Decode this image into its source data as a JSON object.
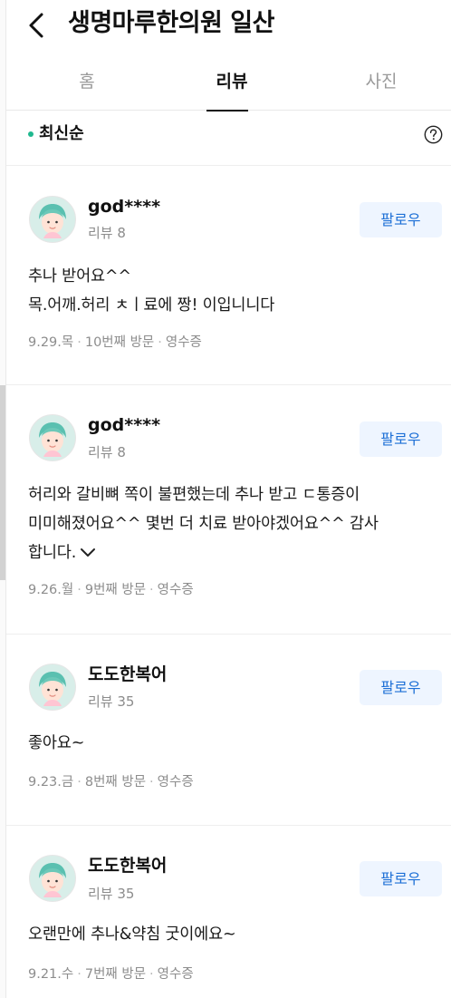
{
  "header": {
    "title": "생명마루한의원 일산",
    "back_icon": "chevron-left-icon"
  },
  "tabs": [
    {
      "label": "홈",
      "active": false
    },
    {
      "label": "리뷰",
      "active": true
    },
    {
      "label": "사진",
      "active": false
    }
  ],
  "sort": {
    "label": "최신순",
    "help_icon": "question-circle-icon"
  },
  "colors": {
    "accent": "#1fb88f",
    "follow_text": "#1c6fd6",
    "follow_bg": "#eef5ff"
  },
  "reviews": [
    {
      "nickname": "god****",
      "review_count": "리뷰 8",
      "follow_label": "팔로우",
      "lines": [
        "추나 받어요^^",
        "목.어깨.허리 ㅊㅣ료에 짱! 이입니니다"
      ],
      "date": "9.29.목",
      "visit": "10번째 방문",
      "receipt": "영수증"
    },
    {
      "nickname": "god****",
      "review_count": "리뷰 8",
      "follow_label": "팔로우",
      "lines": [
        "허리와 갈비뼈 쪽이 불편했는데 추나 받고 ㄷ통증이",
        "미미해졌어요^^ 몇번 더 치료 받아야겠어요^^ 감사",
        "합니다."
      ],
      "more_icon": "chevron-down-icon",
      "date": "9.26.월",
      "visit": "9번째 방문",
      "receipt": "영수증"
    },
    {
      "nickname": "도도한복어",
      "review_count": "리뷰 35",
      "follow_label": "팔로우",
      "lines": [
        "좋아요~"
      ],
      "date": "9.23.금",
      "visit": "8번째 방문",
      "receipt": "영수증"
    },
    {
      "nickname": "도도한복어",
      "review_count": "리뷰 35",
      "follow_label": "팔로우",
      "lines": [
        "오랜만에 추나&약침 굿이에요~"
      ],
      "date": "9.21.수",
      "visit": "7번째 방문",
      "receipt": "영수증"
    }
  ]
}
